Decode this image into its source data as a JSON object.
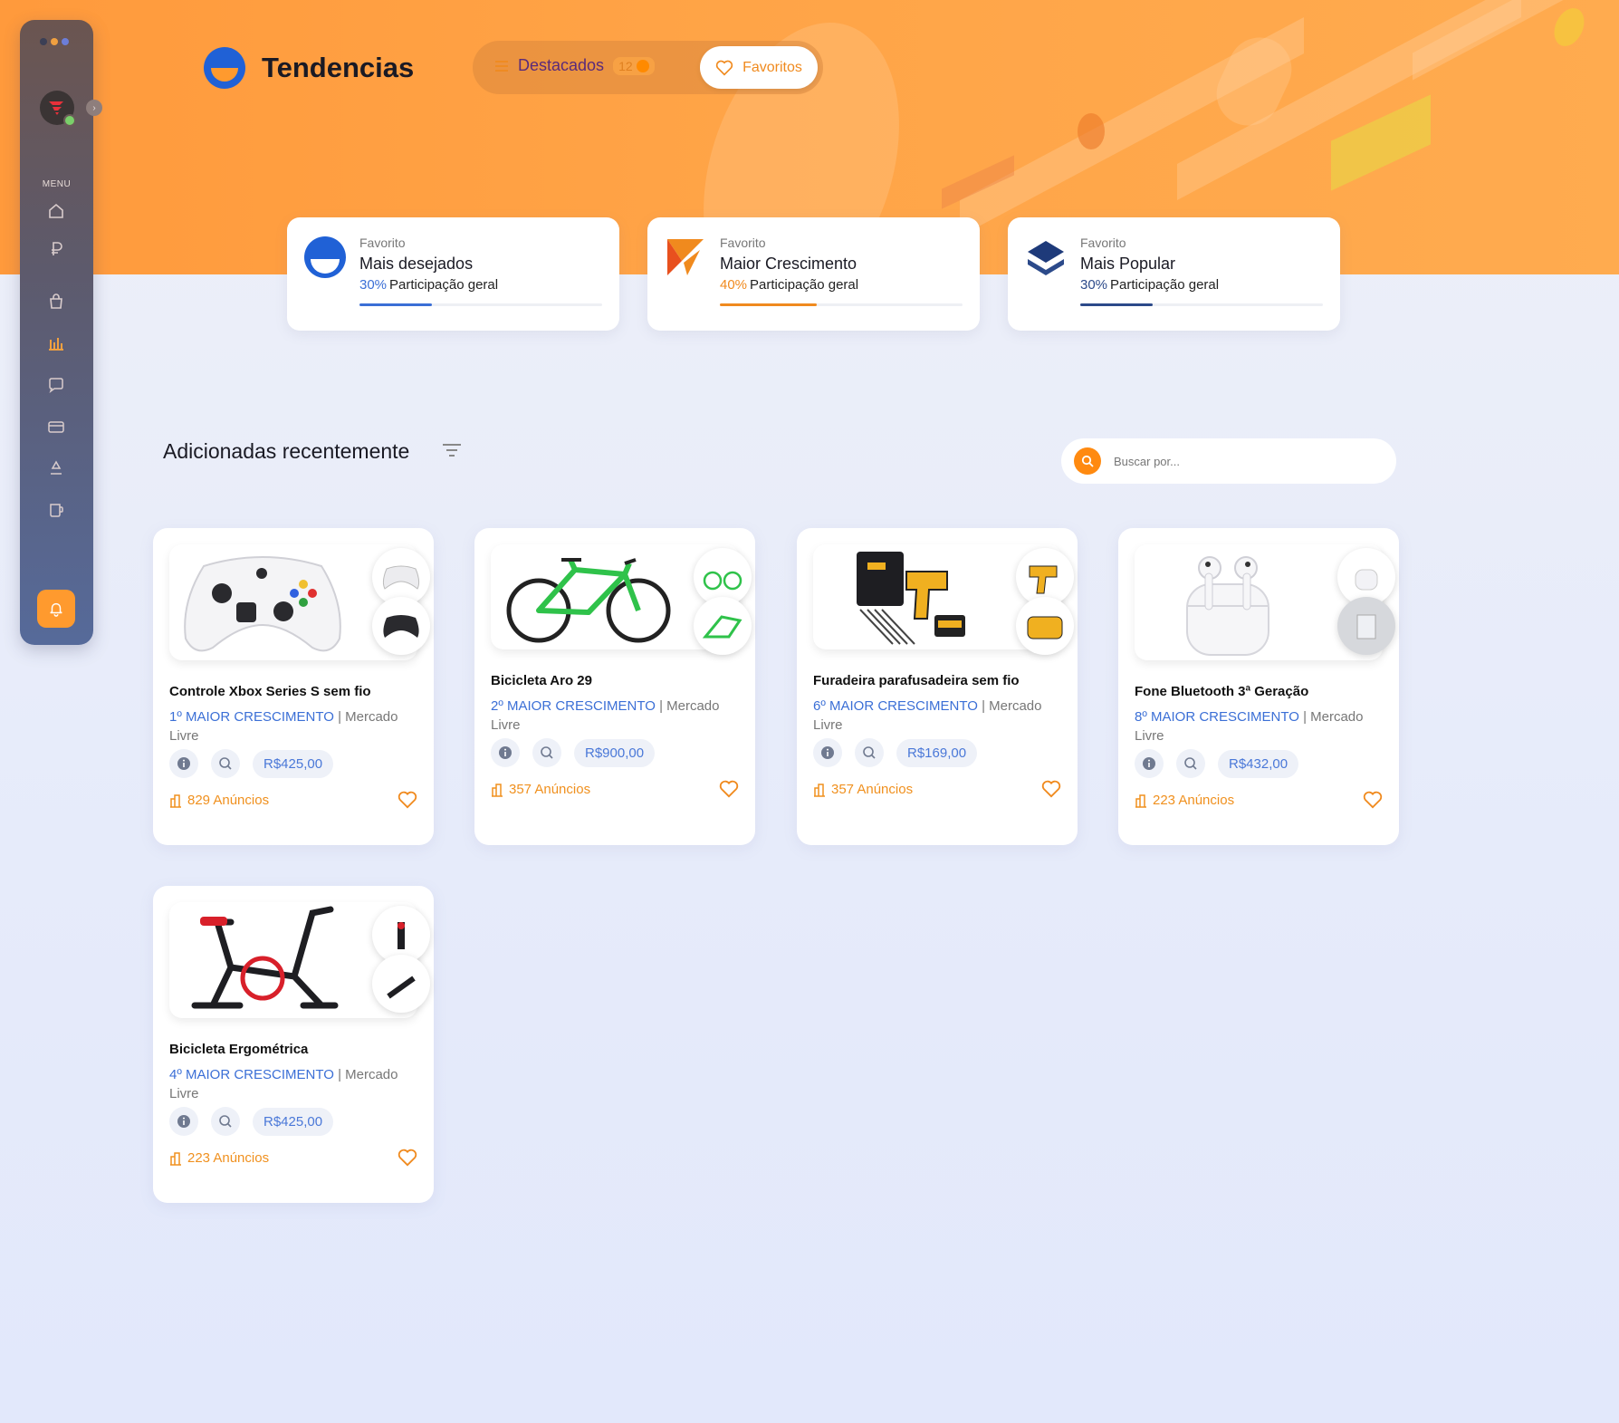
{
  "app": {
    "title": "Tendencias"
  },
  "sidebar": {
    "menu_label": "MENU",
    "window_dots": [
      "#3b3f55",
      "#f0a040",
      "#6c7ed8"
    ],
    "items": [
      {
        "icon": "home-icon"
      },
      {
        "icon": "ruble-icon"
      },
      {
        "icon": "shopping-bag-icon"
      },
      {
        "icon": "bar-chart-icon"
      },
      {
        "icon": "chat-icon"
      },
      {
        "icon": "credit-card-icon"
      },
      {
        "icon": "recycle-icon"
      },
      {
        "icon": "cup-icon"
      }
    ],
    "bell_icon": "bell-icon"
  },
  "tabs": {
    "destacados": {
      "label": "Destacados",
      "count": "12"
    },
    "favoritos": {
      "label": "Favoritos"
    }
  },
  "stats": [
    {
      "category": "Favorito",
      "title": "Mais desejados",
      "pct": "30%",
      "suffix": "Participação geral",
      "progress": 0.3,
      "color": "#3b6fd6"
    },
    {
      "category": "Favorito",
      "title": "Maior Crescimento",
      "pct": "40%",
      "suffix": "Participação geral",
      "progress": 0.4,
      "color": "#f08a1e"
    },
    {
      "category": "Favorito",
      "title": "Mais Popular",
      "pct": "30%",
      "suffix": "Participação geral",
      "progress": 0.3,
      "color": "#2c4a8a"
    }
  ],
  "section": {
    "title": "Adicionadas recentemente"
  },
  "search": {
    "placeholder": "Buscar por..."
  },
  "products": [
    {
      "name": "Controle Xbox Series S sem fio",
      "rank": "1º MAIOR CRESCIMENTO",
      "marketplace": "| Mercado Livre",
      "price": "R$425,00",
      "ads": "829 Anúncios"
    },
    {
      "name": "Bicicleta Aro 29",
      "rank": "2º MAIOR CRESCIMENTO",
      "marketplace": "| Mercado Livre",
      "price": "R$900,00",
      "ads": "357 Anúncios"
    },
    {
      "name": "Furadeira parafusadeira sem fio",
      "rank": "6º MAIOR CRESCIMENTO",
      "marketplace": "| Mercado Livre",
      "price": "R$169,00",
      "ads": "357 Anúncios"
    },
    {
      "name": "Fone Bluetooth 3ª Geração",
      "rank": "8º MAIOR CRESCIMENTO",
      "marketplace": "| Mercado Livre",
      "price": "R$432,00",
      "ads": "223 Anúncios"
    },
    {
      "name": "Bicicleta Ergométrica",
      "rank": "4º MAIOR CRESCIMENTO",
      "marketplace": "| Mercado Livre",
      "price": "R$425,00",
      "ads": "223 Anúncios"
    }
  ]
}
